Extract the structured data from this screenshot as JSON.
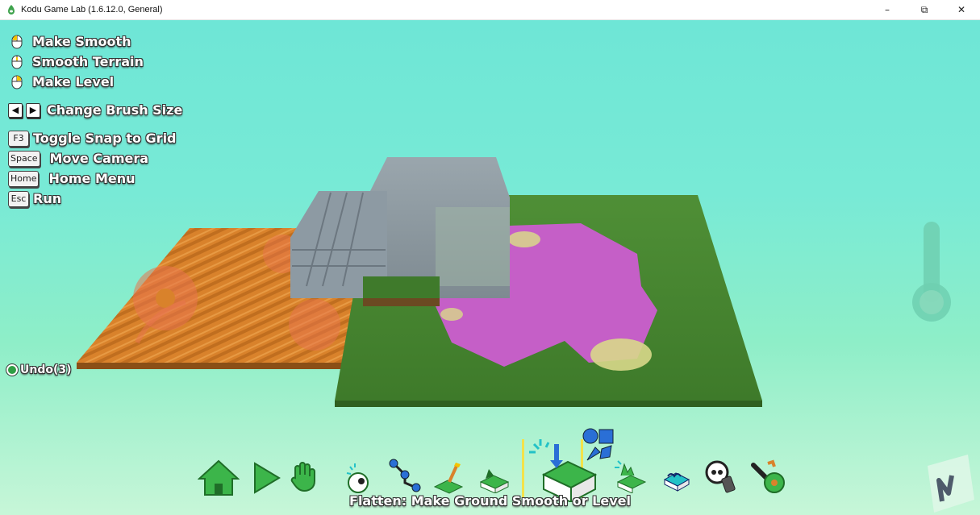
{
  "window": {
    "title": "Kodu Game Lab (1.6.12.0, General)",
    "controls": {
      "minimize": "–",
      "restore": "⧉",
      "close": "✕"
    }
  },
  "help": {
    "mouse_actions": [
      "Make Smooth",
      "Smooth Terrain",
      "Make Level"
    ],
    "brush_size": "Change Brush Size",
    "snap": {
      "key": "F3",
      "label": "Toggle Snap to Grid"
    },
    "camera": {
      "key": "Space",
      "label": "Move Camera"
    },
    "home": {
      "key": "Home",
      "label": "Home Menu"
    },
    "run": {
      "key": "Esc",
      "label": "Run"
    }
  },
  "undo": {
    "label": "Undo(3)"
  },
  "toolbar": {
    "tools": [
      "home-icon",
      "play-icon",
      "hand-icon",
      "object-tool-icon",
      "path-tool-icon",
      "paint-terrain-icon",
      "raise-terrain-icon",
      "flatten-tool-icon",
      "roughen-terrain-icon",
      "water-tool-icon",
      "eraser-tool-icon",
      "world-settings-icon"
    ],
    "selected": "flatten-tool-icon",
    "status": "Flatten: Make Ground Smooth or Level"
  },
  "colors": {
    "sky_top": "#6ee6d6",
    "sky_bottom": "#c7f6d8",
    "text_outline": "#333333"
  }
}
